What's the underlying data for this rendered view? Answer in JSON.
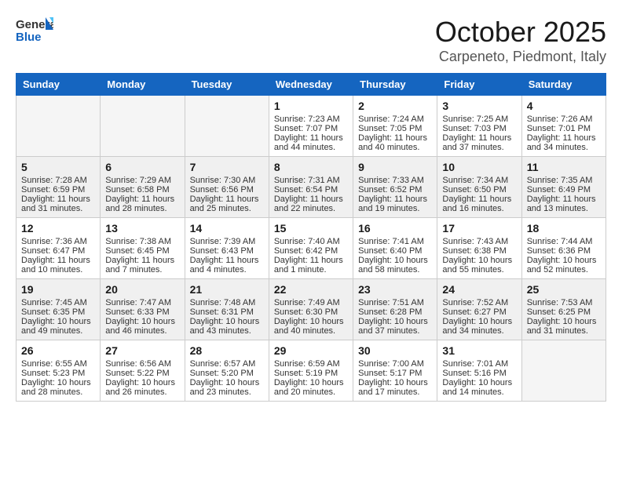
{
  "header": {
    "logo_general": "General",
    "logo_blue": "Blue",
    "title": "October 2025",
    "subtitle": "Carpeneto, Piedmont, Italy"
  },
  "days_of_week": [
    "Sunday",
    "Monday",
    "Tuesday",
    "Wednesday",
    "Thursday",
    "Friday",
    "Saturday"
  ],
  "weeks": [
    {
      "shaded": false,
      "days": [
        {
          "number": "",
          "empty": true,
          "lines": []
        },
        {
          "number": "",
          "empty": true,
          "lines": []
        },
        {
          "number": "",
          "empty": true,
          "lines": []
        },
        {
          "number": "1",
          "empty": false,
          "lines": [
            "Sunrise: 7:23 AM",
            "Sunset: 7:07 PM",
            "Daylight: 11 hours",
            "and 44 minutes."
          ]
        },
        {
          "number": "2",
          "empty": false,
          "lines": [
            "Sunrise: 7:24 AM",
            "Sunset: 7:05 PM",
            "Daylight: 11 hours",
            "and 40 minutes."
          ]
        },
        {
          "number": "3",
          "empty": false,
          "lines": [
            "Sunrise: 7:25 AM",
            "Sunset: 7:03 PM",
            "Daylight: 11 hours",
            "and 37 minutes."
          ]
        },
        {
          "number": "4",
          "empty": false,
          "lines": [
            "Sunrise: 7:26 AM",
            "Sunset: 7:01 PM",
            "Daylight: 11 hours",
            "and 34 minutes."
          ]
        }
      ]
    },
    {
      "shaded": true,
      "days": [
        {
          "number": "5",
          "empty": false,
          "lines": [
            "Sunrise: 7:28 AM",
            "Sunset: 6:59 PM",
            "Daylight: 11 hours",
            "and 31 minutes."
          ]
        },
        {
          "number": "6",
          "empty": false,
          "lines": [
            "Sunrise: 7:29 AM",
            "Sunset: 6:58 PM",
            "Daylight: 11 hours",
            "and 28 minutes."
          ]
        },
        {
          "number": "7",
          "empty": false,
          "lines": [
            "Sunrise: 7:30 AM",
            "Sunset: 6:56 PM",
            "Daylight: 11 hours",
            "and 25 minutes."
          ]
        },
        {
          "number": "8",
          "empty": false,
          "lines": [
            "Sunrise: 7:31 AM",
            "Sunset: 6:54 PM",
            "Daylight: 11 hours",
            "and 22 minutes."
          ]
        },
        {
          "number": "9",
          "empty": false,
          "lines": [
            "Sunrise: 7:33 AM",
            "Sunset: 6:52 PM",
            "Daylight: 11 hours",
            "and 19 minutes."
          ]
        },
        {
          "number": "10",
          "empty": false,
          "lines": [
            "Sunrise: 7:34 AM",
            "Sunset: 6:50 PM",
            "Daylight: 11 hours",
            "and 16 minutes."
          ]
        },
        {
          "number": "11",
          "empty": false,
          "lines": [
            "Sunrise: 7:35 AM",
            "Sunset: 6:49 PM",
            "Daylight: 11 hours",
            "and 13 minutes."
          ]
        }
      ]
    },
    {
      "shaded": false,
      "days": [
        {
          "number": "12",
          "empty": false,
          "lines": [
            "Sunrise: 7:36 AM",
            "Sunset: 6:47 PM",
            "Daylight: 11 hours",
            "and 10 minutes."
          ]
        },
        {
          "number": "13",
          "empty": false,
          "lines": [
            "Sunrise: 7:38 AM",
            "Sunset: 6:45 PM",
            "Daylight: 11 hours",
            "and 7 minutes."
          ]
        },
        {
          "number": "14",
          "empty": false,
          "lines": [
            "Sunrise: 7:39 AM",
            "Sunset: 6:43 PM",
            "Daylight: 11 hours",
            "and 4 minutes."
          ]
        },
        {
          "number": "15",
          "empty": false,
          "lines": [
            "Sunrise: 7:40 AM",
            "Sunset: 6:42 PM",
            "Daylight: 11 hours",
            "and 1 minute."
          ]
        },
        {
          "number": "16",
          "empty": false,
          "lines": [
            "Sunrise: 7:41 AM",
            "Sunset: 6:40 PM",
            "Daylight: 10 hours",
            "and 58 minutes."
          ]
        },
        {
          "number": "17",
          "empty": false,
          "lines": [
            "Sunrise: 7:43 AM",
            "Sunset: 6:38 PM",
            "Daylight: 10 hours",
            "and 55 minutes."
          ]
        },
        {
          "number": "18",
          "empty": false,
          "lines": [
            "Sunrise: 7:44 AM",
            "Sunset: 6:36 PM",
            "Daylight: 10 hours",
            "and 52 minutes."
          ]
        }
      ]
    },
    {
      "shaded": true,
      "days": [
        {
          "number": "19",
          "empty": false,
          "lines": [
            "Sunrise: 7:45 AM",
            "Sunset: 6:35 PM",
            "Daylight: 10 hours",
            "and 49 minutes."
          ]
        },
        {
          "number": "20",
          "empty": false,
          "lines": [
            "Sunrise: 7:47 AM",
            "Sunset: 6:33 PM",
            "Daylight: 10 hours",
            "and 46 minutes."
          ]
        },
        {
          "number": "21",
          "empty": false,
          "lines": [
            "Sunrise: 7:48 AM",
            "Sunset: 6:31 PM",
            "Daylight: 10 hours",
            "and 43 minutes."
          ]
        },
        {
          "number": "22",
          "empty": false,
          "lines": [
            "Sunrise: 7:49 AM",
            "Sunset: 6:30 PM",
            "Daylight: 10 hours",
            "and 40 minutes."
          ]
        },
        {
          "number": "23",
          "empty": false,
          "lines": [
            "Sunrise: 7:51 AM",
            "Sunset: 6:28 PM",
            "Daylight: 10 hours",
            "and 37 minutes."
          ]
        },
        {
          "number": "24",
          "empty": false,
          "lines": [
            "Sunrise: 7:52 AM",
            "Sunset: 6:27 PM",
            "Daylight: 10 hours",
            "and 34 minutes."
          ]
        },
        {
          "number": "25",
          "empty": false,
          "lines": [
            "Sunrise: 7:53 AM",
            "Sunset: 6:25 PM",
            "Daylight: 10 hours",
            "and 31 minutes."
          ]
        }
      ]
    },
    {
      "shaded": false,
      "days": [
        {
          "number": "26",
          "empty": false,
          "lines": [
            "Sunrise: 6:55 AM",
            "Sunset: 5:23 PM",
            "Daylight: 10 hours",
            "and 28 minutes."
          ]
        },
        {
          "number": "27",
          "empty": false,
          "lines": [
            "Sunrise: 6:56 AM",
            "Sunset: 5:22 PM",
            "Daylight: 10 hours",
            "and 26 minutes."
          ]
        },
        {
          "number": "28",
          "empty": false,
          "lines": [
            "Sunrise: 6:57 AM",
            "Sunset: 5:20 PM",
            "Daylight: 10 hours",
            "and 23 minutes."
          ]
        },
        {
          "number": "29",
          "empty": false,
          "lines": [
            "Sunrise: 6:59 AM",
            "Sunset: 5:19 PM",
            "Daylight: 10 hours",
            "and 20 minutes."
          ]
        },
        {
          "number": "30",
          "empty": false,
          "lines": [
            "Sunrise: 7:00 AM",
            "Sunset: 5:17 PM",
            "Daylight: 10 hours",
            "and 17 minutes."
          ]
        },
        {
          "number": "31",
          "empty": false,
          "lines": [
            "Sunrise: 7:01 AM",
            "Sunset: 5:16 PM",
            "Daylight: 10 hours",
            "and 14 minutes."
          ]
        },
        {
          "number": "",
          "empty": true,
          "lines": []
        }
      ]
    }
  ]
}
